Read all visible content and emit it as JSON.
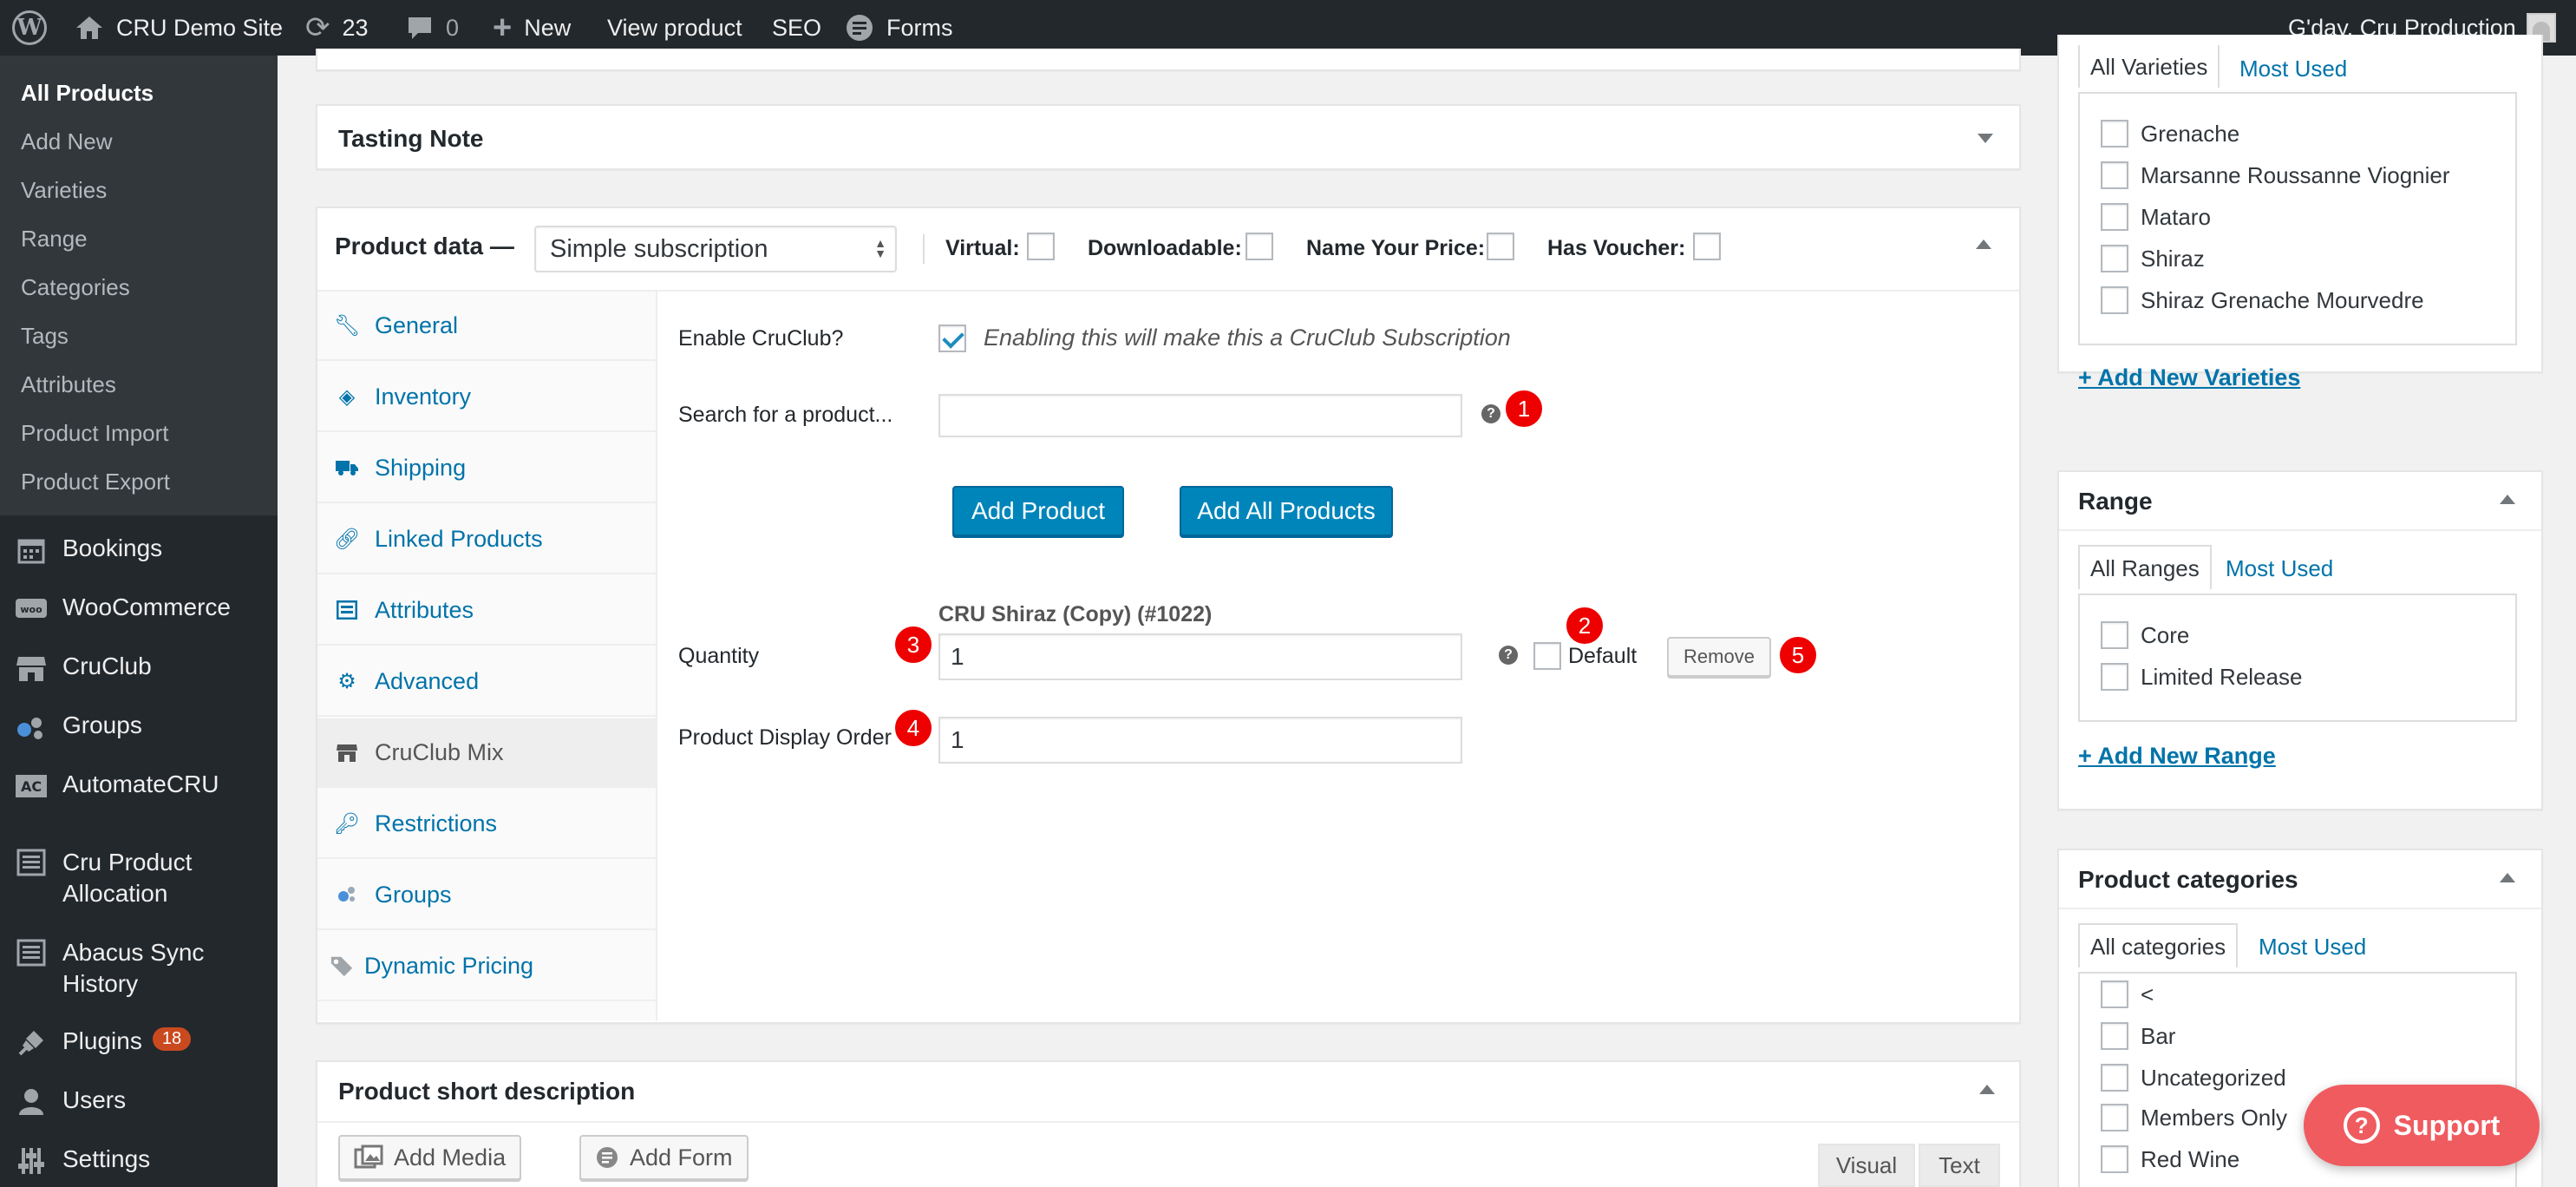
{
  "adminbar": {
    "site_name": "CRU Demo Site",
    "updates_count": "23",
    "comments_count": "0",
    "new_label": "New",
    "view_product": "View product",
    "seo": "SEO",
    "forms": "Forms",
    "greeting": "G'day, Cru Production"
  },
  "sidebar": {
    "submenu": [
      "All Products",
      "Add New",
      "Varieties",
      "Range",
      "Categories",
      "Tags",
      "Attributes",
      "Product Import",
      "Product Export"
    ],
    "menu": [
      {
        "label": "Bookings",
        "icon": "calendar-icon"
      },
      {
        "label": "WooCommerce",
        "icon": "woo-icon"
      },
      {
        "label": "CruClub",
        "icon": "store-icon"
      },
      {
        "label": "Groups",
        "icon": "groups-icon"
      },
      {
        "label": "AutomateCRU",
        "icon": "ac-icon"
      },
      {
        "label": "Cru Product Allocation",
        "icon": "list-icon"
      },
      {
        "label": "Abacus Sync History",
        "icon": "list-icon"
      },
      {
        "label": "Plugins",
        "icon": "plugin-icon",
        "badge": "18"
      },
      {
        "label": "Users",
        "icon": "user-icon"
      },
      {
        "label": "Settings",
        "icon": "settings-icon"
      }
    ],
    "menu_wrapped": {
      "allocation_line1": "Cru Product",
      "allocation_line2": "Allocation",
      "abacus_line1": "Abacus Sync",
      "abacus_line2": "History"
    }
  },
  "tasting_note": {
    "title": "Tasting Note"
  },
  "product_data": {
    "title": "Product data —",
    "type_selected": "Simple subscription",
    "options": {
      "virtual": "Virtual:",
      "downloadable": "Downloadable:",
      "name_your_price": "Name Your Price:",
      "has_voucher": "Has Voucher:"
    },
    "tabs": [
      "General",
      "Inventory",
      "Shipping",
      "Linked Products",
      "Attributes",
      "Advanced",
      "CruClub Mix",
      "Restrictions",
      "Groups",
      "Dynamic Pricing"
    ],
    "panel": {
      "enable_label": "Enable CruClub?",
      "enable_desc": "Enabling this will make this a CruClub Subscription",
      "search_label": "Search for a product...",
      "search_value": "",
      "add_product": "Add Product",
      "add_all_products": "Add All Products",
      "product_name": "CRU Shiraz (Copy) (#1022)",
      "quantity_label": "Quantity",
      "quantity_value": "1",
      "default_label": "Default",
      "remove_label": "Remove",
      "display_order_label": "Product Display Order",
      "display_order_value": "1",
      "help_glyph": "?",
      "callouts": [
        "1",
        "2",
        "3",
        "4",
        "5"
      ]
    }
  },
  "short_description": {
    "title": "Product short description",
    "add_media": "Add Media",
    "add_form": "Add Form",
    "visual": "Visual",
    "text": "Text"
  },
  "varieties": {
    "tab_all": "All Varieties",
    "tab_most_used": "Most Used",
    "items": [
      "Grenache",
      "Marsanne Roussanne Viognier",
      "Mataro",
      "Shiraz",
      "Shiraz Grenache Mourvedre"
    ],
    "add_new": "+ Add New Varieties"
  },
  "range": {
    "title": "Range",
    "tab_all": "All Ranges",
    "tab_most_used": "Most Used",
    "items": [
      "Core",
      "Limited Release"
    ],
    "add_new": "+ Add New Range"
  },
  "categories": {
    "title": "Product categories",
    "tab_all": "All categories",
    "tab_most_used": "Most Used",
    "items": [
      "<",
      "Bar",
      "Uncategorized",
      "Members Only",
      "Red Wine"
    ]
  },
  "support": {
    "label": "Support",
    "icon_glyph": "?"
  },
  "colors": {
    "accent": "#0073aa",
    "primary_button": "#0085ba",
    "callout": "#ee0000",
    "support": "#ef5b5f",
    "adminbar": "#23282d"
  }
}
